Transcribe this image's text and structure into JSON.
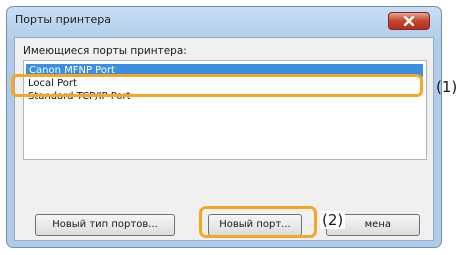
{
  "dialog": {
    "title": "Порты принтера",
    "close_icon": "close-icon"
  },
  "ports": {
    "label": "Имеющиеся порты принтера:",
    "items": [
      "Canon MFNP Port",
      "Local Port",
      "Standard TCP/IP Port"
    ],
    "selected_index": 0
  },
  "buttons": {
    "new_port_type": "Новый тип портов...",
    "new_port": "Новый порт...",
    "cancel": "мена"
  },
  "callouts": {
    "one": "(1)",
    "two": "(2)"
  },
  "colors": {
    "highlight": "#f5a623",
    "selection": "#3a8fe0"
  }
}
